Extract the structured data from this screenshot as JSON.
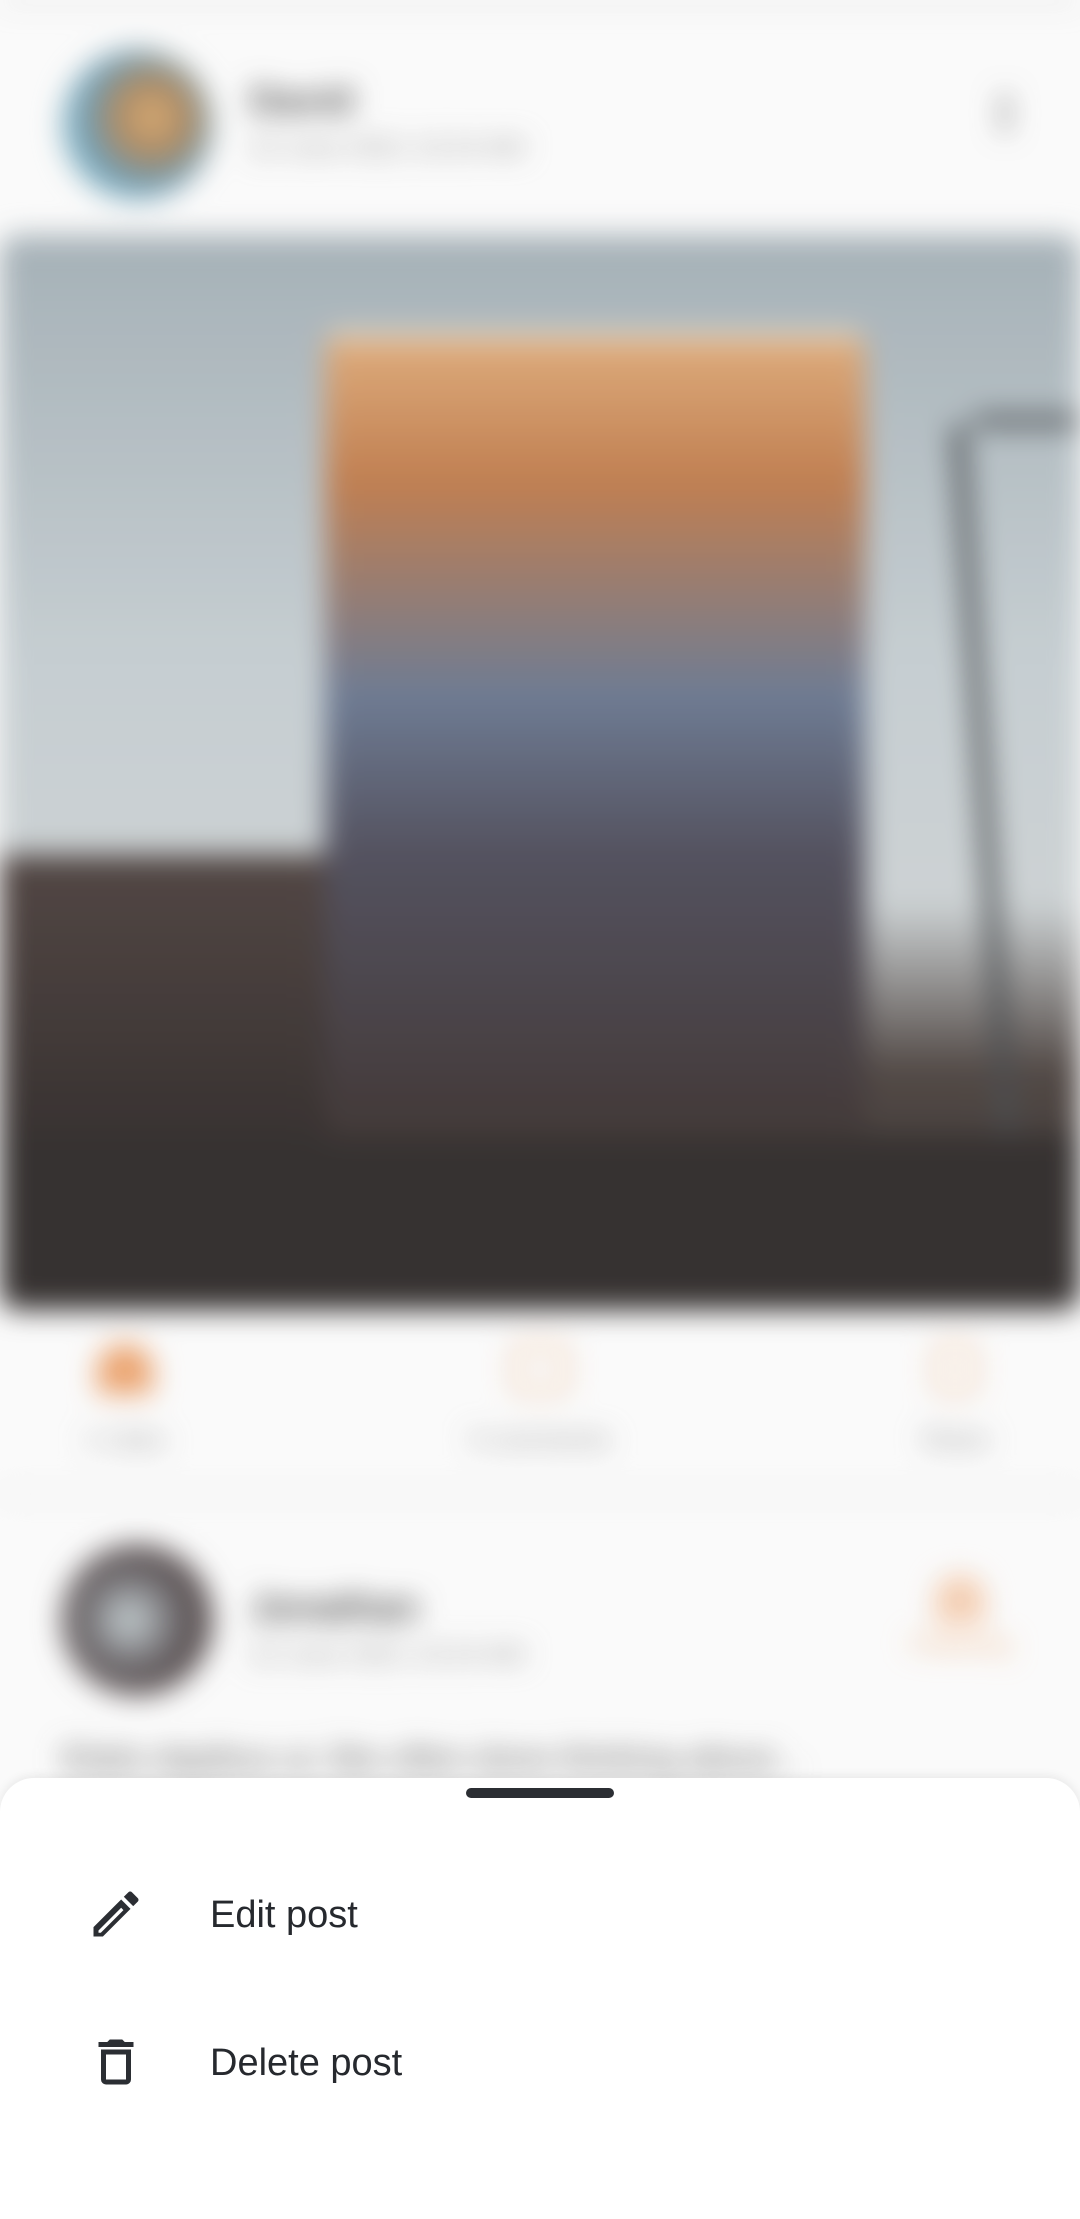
{
  "post": {
    "author": "David",
    "date": "22 June 2021 10:24 AM",
    "actions": [
      {
        "label": "1 Likes",
        "icon": "heart-icon"
      },
      {
        "label": "0 comments",
        "icon": "comment-icon"
      },
      {
        "label": "Share",
        "icon": "share-icon"
      }
    ]
  },
  "next_post": {
    "author": "Jonathan",
    "date": "22 June 2021 10:24 AM",
    "follow_label": "Following",
    "text": "Elatis dapibus ut, like often done thinking about..."
  },
  "sheet": {
    "items": [
      {
        "label": "Edit post",
        "icon": "pencil-icon"
      },
      {
        "label": "Delete post",
        "icon": "trash-icon"
      }
    ]
  },
  "colors": {
    "accent": "#e8965a",
    "sheet_text": "#26292e",
    "sheet_background": "#ffffff"
  }
}
